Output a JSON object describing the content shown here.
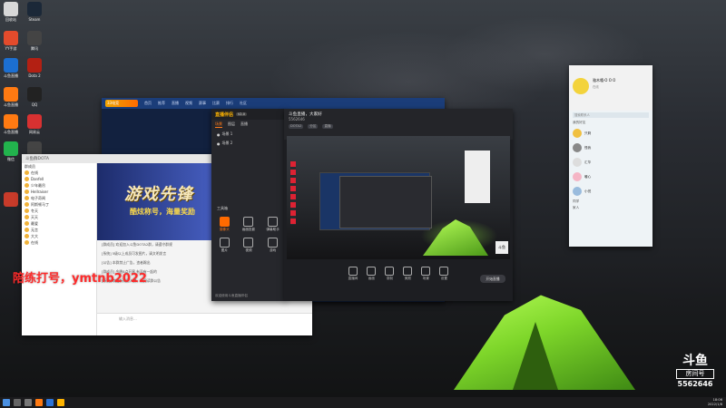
{
  "desktop": {
    "icons": [
      {
        "label": "回收站",
        "color": "#d8d8d8"
      },
      {
        "label": "Steam",
        "color": "#1b2838"
      },
      {
        "label": "YY手游",
        "color": "#e34b2c"
      },
      {
        "label": "腾讯",
        "color": "#444"
      },
      {
        "label": "斗鱼直播",
        "color": "#1c6fd1"
      },
      {
        "label": "Dota 2",
        "color": "#b32013"
      },
      {
        "label": "斗鱼直播",
        "color": "#ff7a12"
      },
      {
        "label": "QQ",
        "color": "#222"
      },
      {
        "label": "斗鱼直播",
        "color": "#ff7a12"
      },
      {
        "label": "网易云",
        "color": "#d83131"
      },
      {
        "label": "微信",
        "color": "#22b34d"
      },
      {
        "label": "",
        "color": "#444"
      },
      {
        "label": "",
        "color": "#c83b2a"
      }
    ]
  },
  "blue_window": {
    "logo": "33电竞",
    "nav": [
      "首页",
      "推荐",
      "直播",
      "视频",
      "赛事",
      "比赛",
      "排行",
      "社区"
    ]
  },
  "chat_window": {
    "title": "斗鱼群DOTA",
    "sidebar_label": "群成员",
    "members": [
      "在线",
      "Danfell",
      "少年最吊",
      "Hellraiser",
      "电子奇闻",
      "阿斯顿马丁",
      "冬天",
      "天天",
      "最爱",
      "无言",
      "大大",
      "在线"
    ],
    "banner_title": "游戏先锋",
    "banner_sub": "酷炫称号，海量奖励",
    "messages": [
      "[群成员] 欢迎加入斗鱼DOTA2群，请遵守群规",
      "[系统] 5级以上成员可发图片，请文明发言",
      "[公告] 本群禁止广告，违者踢出",
      "[群成员] 今晚8点开黑 有没有一起的",
      "[系统] 欢迎新成员入群，请阅读群公告"
    ],
    "input_placeholder": "输入消息..."
  },
  "assistant": {
    "logo": "直播伴侣",
    "version": "V2.0",
    "tabs": [
      "场景",
      "图层",
      "直播"
    ],
    "scenes": [
      "场景 1",
      "场景 2"
    ],
    "tools_title": "工具箱",
    "tools": [
      "摄像头",
      "画面投影",
      "弹幕助手",
      "图片",
      "视频",
      "游戏"
    ],
    "footer": "欢迎使用斗鱼直播伴侣"
  },
  "main_window": {
    "title": "斗鱼直播，大家好",
    "room_id": "5562646",
    "tags": [
      "DOTA2",
      "分区",
      "直播"
    ],
    "preview_logo": "斗鱼",
    "tools": [
      "直播间",
      "画面",
      "录制",
      "美颜",
      "场景",
      "设置"
    ],
    "start_button": "开始直播"
  },
  "friends": {
    "name": "骆木嘻·O O O",
    "status": "在线",
    "search": "搜索联系人",
    "groups": [
      "我的好友",
      "同学",
      "家人"
    ],
    "items": [
      "只剩",
      "怪我",
      "汇华",
      "暖心",
      "小悦"
    ]
  },
  "overlay_text": "陪练打号，ymtnb2022",
  "watermark": {
    "logo": "斗鱼",
    "room_label": "房间号",
    "room_number": "5562646"
  },
  "taskbar": {
    "time": "18:06",
    "date": "2022/1/8"
  }
}
